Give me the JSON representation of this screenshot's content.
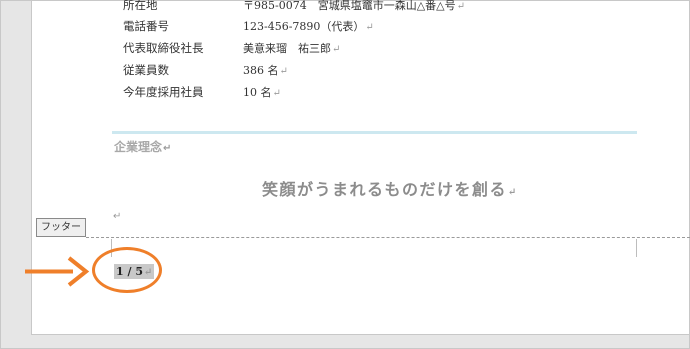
{
  "company_info": [
    {
      "label": "所在地",
      "value": "〒985-0074　宮城県塩竈市一森山△番△号"
    },
    {
      "label": "電話番号",
      "value": "123-456-7890（代表）"
    },
    {
      "label": "代表取締役社長",
      "value": "美意来瑠　祐三郎"
    },
    {
      "label": "従業員数",
      "value": "386 名"
    },
    {
      "label": "今年度採用社員",
      "value": "10 名"
    }
  ],
  "section": {
    "heading": "企業理念"
  },
  "motto": "笑顔がうまれるものだけを創る",
  "footer": {
    "tab_label": "フッター",
    "page_number": "1 / 5"
  },
  "marks": {
    "return": "↵"
  },
  "colors": {
    "highlight_circle": "#ef7f2a",
    "rule": "#cde8f0"
  }
}
